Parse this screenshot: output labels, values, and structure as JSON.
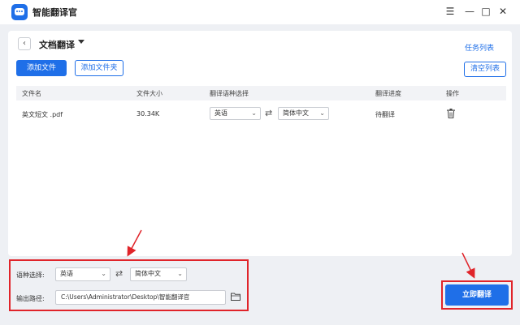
{
  "app": {
    "title": "智能翻译官"
  },
  "window_controls": {
    "menu": "☰",
    "minimize": "—",
    "maximize": "□",
    "close": "✕"
  },
  "header": {
    "back": "‹",
    "title": "文档翻译",
    "task_list": "任务列表"
  },
  "toolbar": {
    "add_file": "添加文件",
    "add_folder": "添加文件夹",
    "clear_list": "清空列表"
  },
  "table": {
    "columns": [
      "文件名",
      "文件大小",
      "翻译语种选择",
      "翻译进度",
      "操作"
    ],
    "rows": [
      {
        "name": "英文短文 .pdf",
        "size": "30.34K",
        "source_lang": "英语",
        "target_lang": "简体中文",
        "status": "待翻译"
      }
    ]
  },
  "settings": {
    "language_label": "语种选择:",
    "source_lang": "英语",
    "target_lang": "简体中文",
    "output_label": "输出路径:",
    "output_path": "C:\\Users\\Administrator\\Desktop\\智能翻译官"
  },
  "actions": {
    "translate_now": "立即翻译"
  },
  "colors": {
    "primary": "#1f6fe8",
    "highlight": "#e0242a",
    "background": "#eef0f4"
  }
}
